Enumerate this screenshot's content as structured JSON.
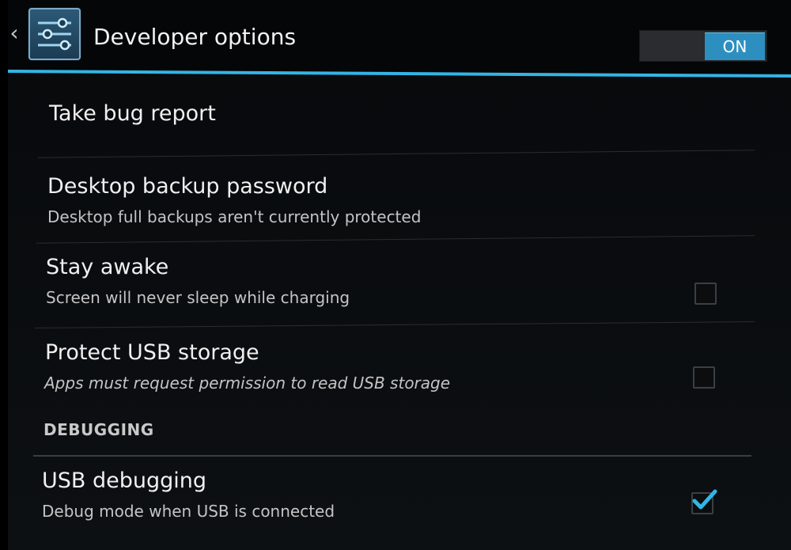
{
  "action_bar": {
    "up_icon": "chevron-left-icon",
    "app_icon": "settings-sliders-icon",
    "title": "Developer options",
    "master_switch": {
      "state": "ON",
      "on": true
    }
  },
  "settings": [
    {
      "primary": "Take bug report",
      "summary": ""
    },
    {
      "primary": "Desktop backup password",
      "summary": "Desktop full backups aren't currently protected"
    },
    {
      "primary": "Stay awake",
      "summary": "Screen will never sleep while charging",
      "checked": false
    },
    {
      "primary": "Protect USB storage",
      "summary": "Apps must request permission to read USB storage",
      "checked": false
    }
  ],
  "debugging": {
    "header": "DEBUGGING",
    "items": [
      {
        "primary": "USB debugging",
        "summary": "Debug mode when USB is connected",
        "checked": true
      }
    ]
  },
  "colors": {
    "accent": "#33b5e5",
    "background": "#0a0c0e",
    "switch_on": "#2c8fc0"
  }
}
